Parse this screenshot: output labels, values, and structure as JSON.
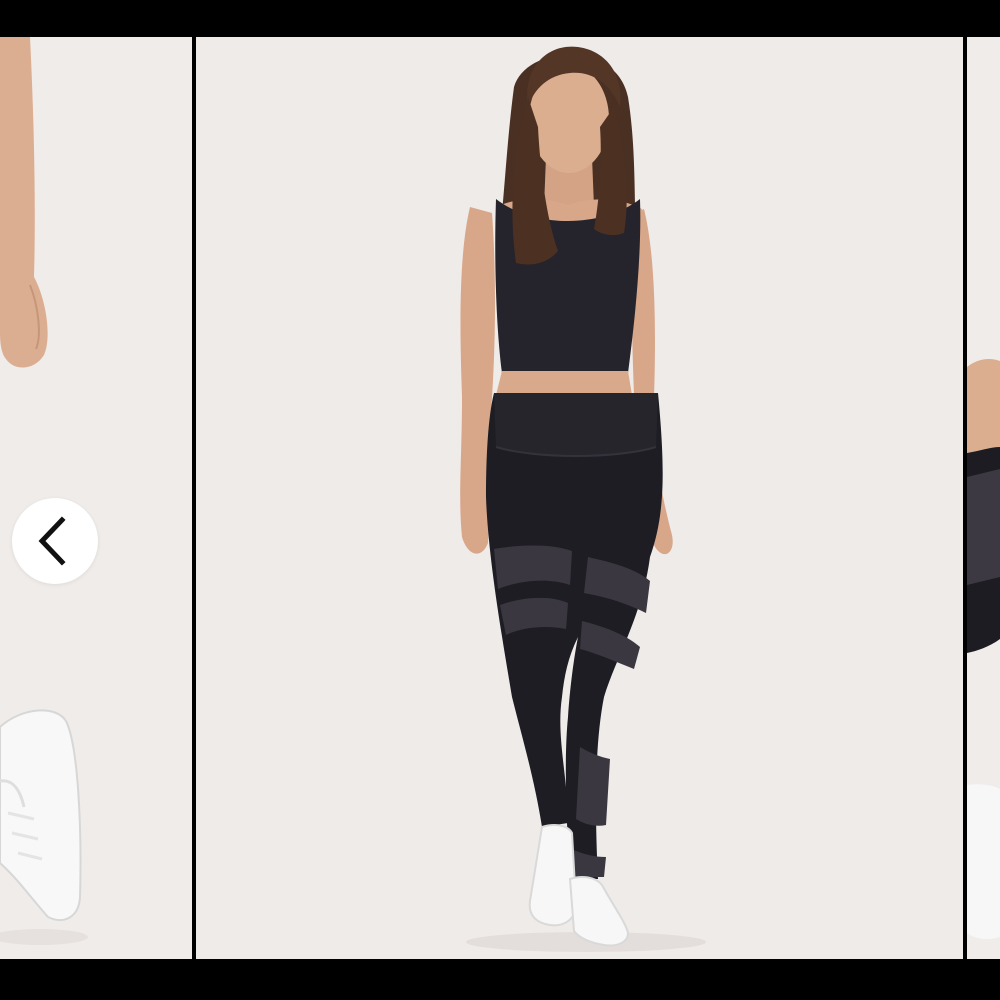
{
  "carousel": {
    "nav": {
      "prev_icon": "chevron-left-icon"
    },
    "slides": [
      {
        "position": "previous",
        "subject": "arm-and-white-sneaker"
      },
      {
        "position": "current",
        "subject": "model-black-crop-tank-and-mesh-leggings"
      },
      {
        "position": "next",
        "subject": "mesh-legging-detail-and-sneaker"
      }
    ]
  },
  "colors": {
    "frame": "#000000",
    "backdrop": "#efebe9",
    "apparel": "#1e1d24",
    "mesh": "#3a3640",
    "skin": "#d9a98b",
    "sneaker": "#f7f7f7",
    "arrow_bg": "#ffffff",
    "arrow_icon": "#111111"
  }
}
